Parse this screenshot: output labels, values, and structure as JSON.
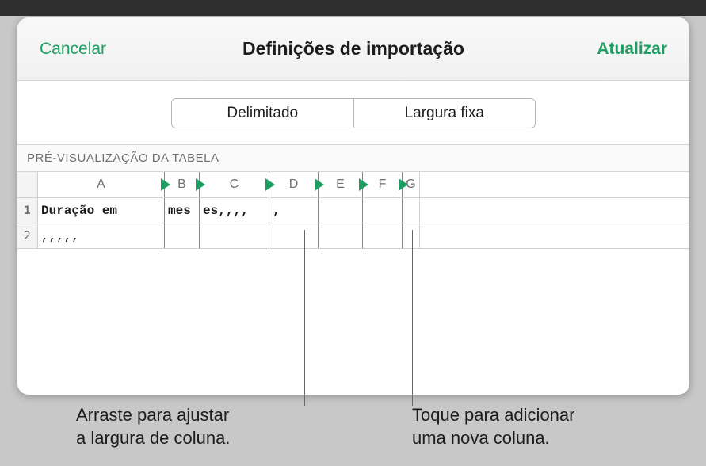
{
  "header": {
    "title": "Definições de importação",
    "cancel": "Cancelar",
    "update": "Atualizar"
  },
  "segmented": {
    "delimited": "Delimitado",
    "fixed": "Largura fixa"
  },
  "sectionLabel": "PRÉ-VISUALIZAÇÃO DA TABELA",
  "columns": [
    "A",
    "B",
    "C",
    "D",
    "E",
    "F",
    "G"
  ],
  "rows": {
    "r1": {
      "num": "1",
      "cells": [
        "Duração em ",
        "mes",
        "es,,,,",
        ",",
        "",
        "",
        ""
      ]
    },
    "r2": {
      "num": "2",
      "cells": [
        ",,,,,",
        "",
        "",
        "",
        "",
        "",
        ""
      ]
    }
  },
  "callouts": {
    "drag_l1": "Arraste para ajustar",
    "drag_l2": "a largura de coluna.",
    "tap_l1": "Toque para adicionar",
    "tap_l2": "uma nova coluna."
  }
}
